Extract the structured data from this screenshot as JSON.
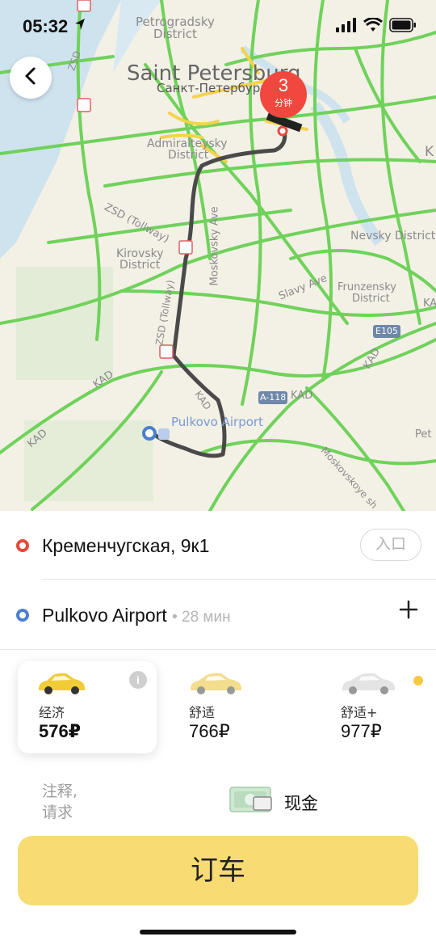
{
  "status_bar": {
    "time": "05:32"
  },
  "map": {
    "labels": {
      "petrogradsky": "Petrogradsky",
      "petrogradsky_district": "District",
      "city_en": "Saint Petersburg",
      "city_ru": "Санкт-Петербург",
      "admiralteysky": "Admiralteysky",
      "admiralteysky_district": "District",
      "zsd_tollway": "ZSD (Tollway)",
      "zsd_tollway_2": "ZSD (Tollway)",
      "zsd": "ZSD",
      "kirovsky": "Kirovsky",
      "kirovsky_district": "District",
      "moskovsky_ave": "Moskovsky Ave",
      "nevsky": "Nevsky District",
      "slavy_ave": "Slavy Ave",
      "frunzensky": "Frunzensky",
      "frunzensky_district": "District",
      "e105": "E105",
      "a118": "A-118",
      "kad_1": "KAD",
      "kad_2": "KAD",
      "kad_3": "KAD",
      "kad_4": "KAD",
      "kad_5": "KAD",
      "kad_6": "KAD",
      "pulkovo_airport": "Pulkovo Airport",
      "moskovskoye": "Moskovskoye sh",
      "pet_edge": "Pet",
      "k_edge": "K",
      "ka_edge": "KA"
    },
    "eta_badge": {
      "number": "3",
      "unit": "分钟"
    },
    "colors": {
      "traffic_green": "#6fd25a",
      "traffic_yellow": "#f4d34b",
      "water": "#cfe3ef",
      "route": "#4a4a4a"
    }
  },
  "trip": {
    "from": {
      "address": "Кременчугская, 9к1",
      "entrance_label": "入口",
      "dot_color": "#e84a3b"
    },
    "to": {
      "address": "Pulkovo Airport",
      "duration": "• 28 мин",
      "dot_color": "#4a7fd1"
    }
  },
  "tariffs": [
    {
      "name": "经济",
      "price": "576₽",
      "selected": true,
      "car_color": "#f1cc39"
    },
    {
      "name": "舒适",
      "price": "766₽",
      "selected": false,
      "car_color": "#f3dd8e"
    },
    {
      "name": "舒适+",
      "price": "977₽",
      "selected": false,
      "car_color": "#e4e4e4"
    }
  ],
  "options": {
    "comment_line1": "注释,",
    "comment_line2": "请求",
    "payment_label": "现金"
  },
  "order_button": {
    "label": "订车",
    "color": "#f8dc73"
  }
}
